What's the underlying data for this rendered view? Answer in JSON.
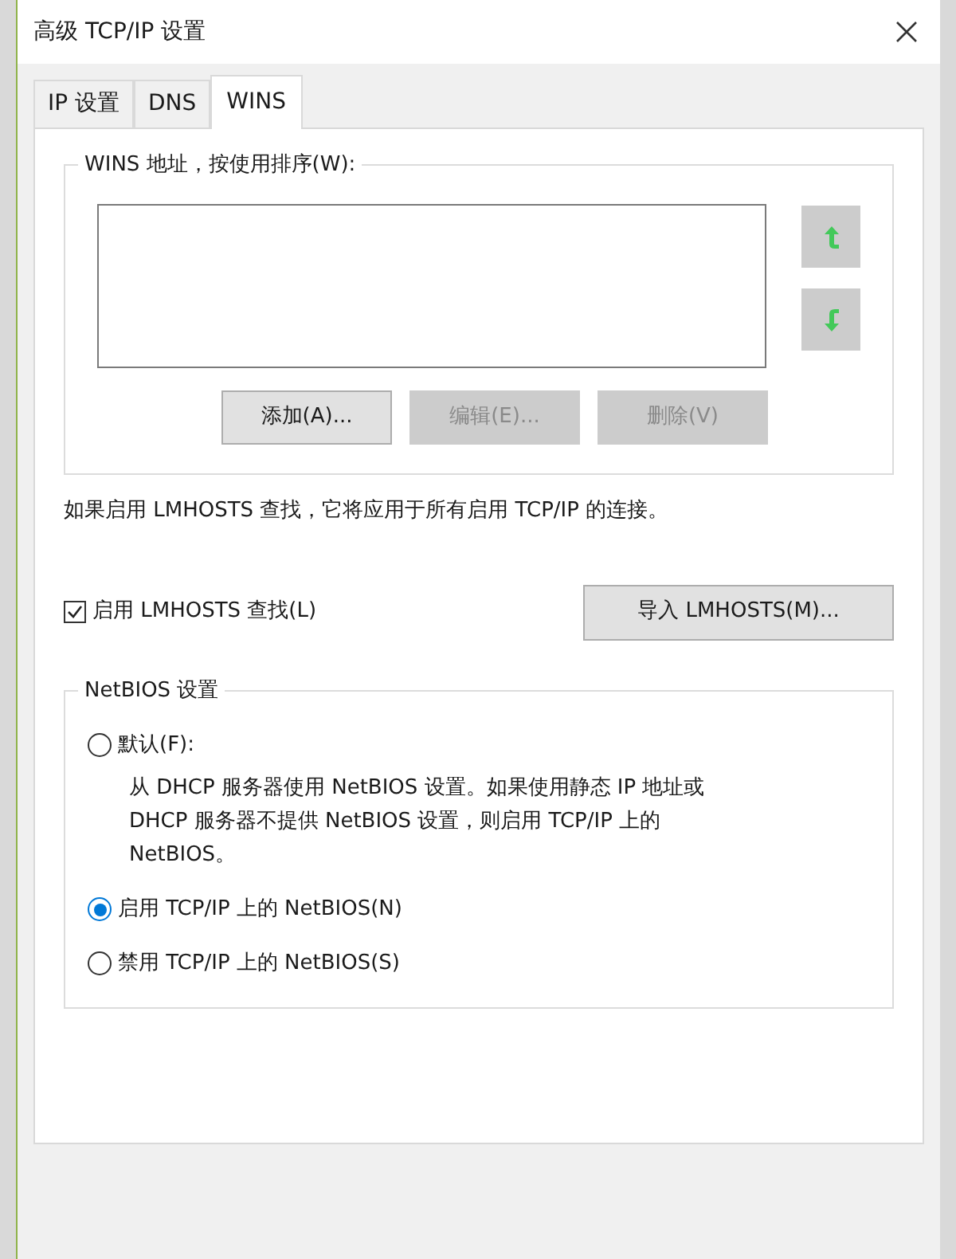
{
  "window": {
    "title": "高级 TCP/IP 设置"
  },
  "tabs": [
    {
      "label": "IP 设置",
      "selected": false
    },
    {
      "label": "DNS",
      "selected": false
    },
    {
      "label": "WINS",
      "selected": true
    }
  ],
  "wins_group": {
    "title": "WINS 地址，按使用排序(W):",
    "buttons": [
      {
        "label": "添加(A)...",
        "disabled": false
      },
      {
        "label": "编辑(E)...",
        "disabled": true
      },
      {
        "label": "删除(V)",
        "disabled": true
      }
    ]
  },
  "info_text": "如果启用 LMHOSTS 查找，它将应用于所有启用 TCP/IP 的连接。",
  "lmhosts_checkbox": {
    "label": "启用 LMHOSTS 查找(L)",
    "checked": true
  },
  "import_button": "导入 LMHOSTS(M)...",
  "netbios_group": {
    "title": "NetBIOS 设置",
    "options": [
      {
        "label": "默认(F):",
        "selected": false,
        "description": [
          "从 DHCP 服务器使用 NetBIOS 设置。如果使用静态 IP 地址或",
          "DHCP 服务器不提供 NetBIOS 设置，则启用 TCP/IP 上的",
          "NetBIOS。"
        ]
      },
      {
        "label": "启用 TCP/IP 上的 NetBIOS(N)",
        "selected": true
      },
      {
        "label": "禁用 TCP/IP 上的 NetBIOS(S)",
        "selected": false
      }
    ]
  }
}
